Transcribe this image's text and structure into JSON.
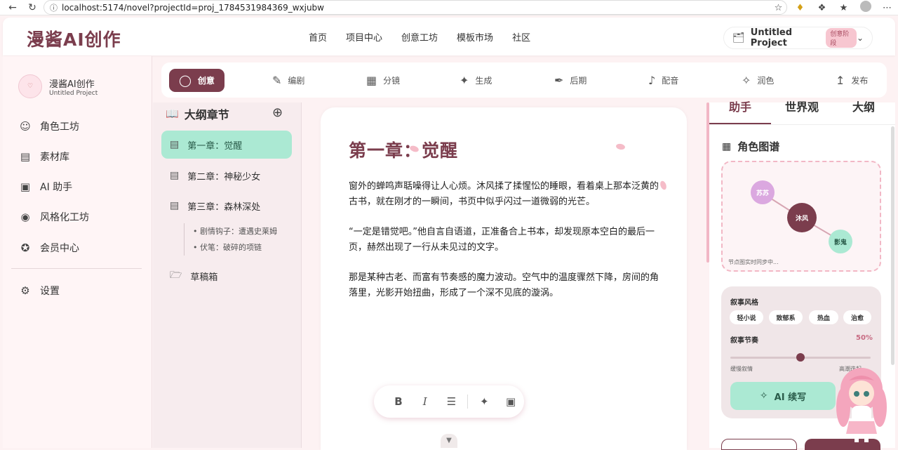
{
  "browser": {
    "url": "localhost:5174/novel?projectId=proj_1784531984369_wxjubw",
    "icons": [
      "back-icon",
      "refresh-icon",
      "info-icon",
      "star-icon",
      "extension-icon",
      "puzzle-icon",
      "favorites-icon",
      "profile-icon",
      "more-icon"
    ]
  },
  "header": {
    "logo": "漫酱AI创作",
    "nav": [
      "首页",
      "项目中心",
      "创意工坊",
      "模板市场",
      "社区"
    ],
    "project": {
      "name": "Untitled Project",
      "stage": "创意阶段"
    }
  },
  "sidebar": {
    "brand_title": "漫酱AI创作",
    "brand_subtitle": "Untitled Project",
    "items": [
      {
        "label": "角色工坊",
        "icon": "face-icon"
      },
      {
        "label": "素材库",
        "icon": "archive-icon"
      },
      {
        "label": "AI 助手",
        "icon": "robot-icon"
      },
      {
        "label": "风格化工坊",
        "icon": "palette-icon"
      },
      {
        "label": "会员中心",
        "icon": "star-badge-icon"
      }
    ],
    "settings": "设置"
  },
  "toolbar": {
    "tools": [
      {
        "label": "创意",
        "icon": "lightbulb-icon",
        "active": true
      },
      {
        "label": "编剧",
        "icon": "script-icon"
      },
      {
        "label": "分镜",
        "icon": "storyboard-icon"
      },
      {
        "label": "生成",
        "icon": "sparkle-icon"
      },
      {
        "label": "后期",
        "icon": "brush-icon"
      },
      {
        "label": "配音",
        "icon": "mic-icon"
      },
      {
        "label": "润色",
        "icon": "magic-wand-icon"
      },
      {
        "label": "发布",
        "icon": "upload-icon"
      }
    ]
  },
  "outline": {
    "title": "大纲章节",
    "chapters": [
      "第一章：觉醒",
      "第二章：神秘少女",
      "第三章：森林深处"
    ],
    "active_chapter": 0,
    "sub_items": [
      "剧情钩子：遭遇史莱姆",
      "伏笔：破碎的项链"
    ],
    "drafts": "草稿箱"
  },
  "editor": {
    "title": "第一章：觉醒",
    "paragraphs": [
      "窗外的蝉鸣声聒噪得让人心烦。沐风揉了揉惺忪的睡眼，看着桌上那本泛黄的古书，就在刚才的一瞬间，书页中似乎闪过一道微弱的光芒。",
      "“一定是错觉吧。”他自言自语道，正准备合上书本，却发现原本空白的最后一页，赫然出现了一行从未见过的文字。",
      "那是某种古老、而富有节奏感的魔力波动。空气中的温度骤然下降，房间的角落里，光影开始扭曲，形成了一个深不见底的漩涡。"
    ],
    "format_tools": [
      "B",
      "I"
    ]
  },
  "right_panel": {
    "tabs": [
      "助手",
      "世界观",
      "大纲"
    ],
    "active_tab": 0,
    "graph_title": "角色图谱",
    "nodes": [
      "苏苏",
      "沐风",
      "影鬼"
    ],
    "graph_note": "节点图实时同步中...",
    "style_label": "叙事风格",
    "styles": [
      "轻小说",
      "致郁系",
      "热血",
      "治愈"
    ],
    "rhythm_label": "叙事节奏",
    "rhythm_value": "50%",
    "rhythm_fraction": 0.5,
    "rhythm_min": "缓慢叙情",
    "rhythm_max": "高潮迭起",
    "ai_button": "AI 续写"
  },
  "colors": {
    "accent": "#7b3d4d",
    "mint": "#abe9d3",
    "pink": "#f2b7c5"
  }
}
